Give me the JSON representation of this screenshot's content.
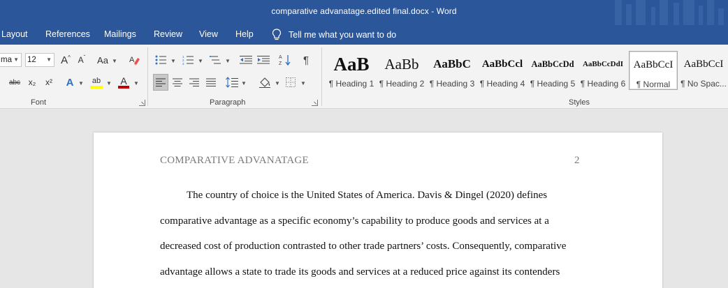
{
  "window": {
    "title": "comparative advanatage.edited final.docx  -  Word"
  },
  "menu": {
    "items": [
      "Layout",
      "References",
      "Mailings",
      "Review",
      "View",
      "Help"
    ],
    "tell_me": "Tell me what you want to do"
  },
  "font_group": {
    "font_name": "ma",
    "font_size": "12",
    "label": "Font",
    "grow_glyph": "A",
    "shrink_glyph": "A",
    "change_case_glyph": "Aa",
    "strikethrough_glyph": "abc",
    "subscript_glyph": "x₂",
    "superscript_glyph": "x²",
    "text_effects_glyph": "A",
    "highlight_glyph": "ab",
    "font_color_glyph": "A"
  },
  "paragraph_group": {
    "label": "Paragraph"
  },
  "styles_group": {
    "label": "Styles",
    "items": [
      {
        "sample": "AaB",
        "name": "¶ Heading 1"
      },
      {
        "sample": "AaBb",
        "name": "¶ Heading 2"
      },
      {
        "sample": "AaBbC",
        "name": "¶ Heading 3"
      },
      {
        "sample": "AaBbCcl",
        "name": "¶ Heading 4"
      },
      {
        "sample": "AaBbCcDd",
        "name": "¶ Heading 5"
      },
      {
        "sample": "AaBbCcDdI",
        "name": "¶ Heading 6"
      },
      {
        "sample": "AaBbCcI",
        "name": "¶ Normal"
      },
      {
        "sample": "AaBbCcI",
        "name": "¶ No Spac..."
      }
    ]
  },
  "document": {
    "header": "COMPARATIVE ADVANATAGE",
    "page_number": "2",
    "lines": [
      "The country of choice is the United States of America. Davis & Dingel (2020) defines",
      "comparative advantage as a specific economy’s capability to produce goods and services at a",
      "decreased cost of production contrasted to other trade partners’ costs. Consequently, comparative",
      "advantage allows a state to trade its goods and services at a reduced price against its contenders"
    ]
  },
  "colors": {
    "title_bar": "#2b579a",
    "ribbon": "#f3f3f3",
    "workspace": "#e6e6e6",
    "font_color_accent": "#c00000",
    "highlight_accent": "#ffff00"
  }
}
